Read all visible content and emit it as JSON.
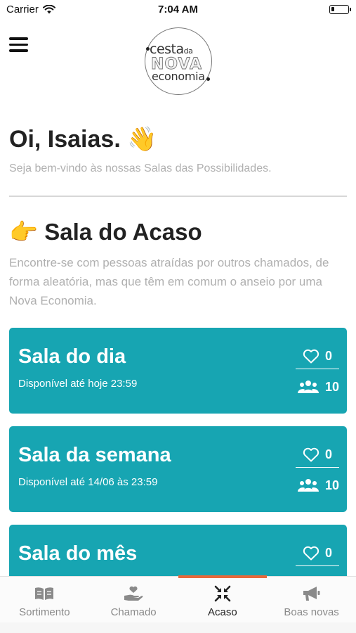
{
  "status_bar": {
    "carrier": "Carrier",
    "time": "7:04 AM"
  },
  "logo": {
    "line1": "cesta",
    "line1_small": "da",
    "line2": "NOVA",
    "line3": "economia"
  },
  "greeting": {
    "title": "Oi, Isaias. 👋",
    "subtitle": "Seja bem-vindo às nossas Salas das Possibilidades."
  },
  "section": {
    "title": "👉 Sala do Acaso",
    "description": "Encontre-se com pessoas atraídas por outros chamados, de forma aleatória, mas que têm em comum o anseio por uma Nova Economia."
  },
  "rooms": [
    {
      "title": "Sala do dia",
      "availability": "Disponível até hoje 23:59",
      "likes": "0",
      "members": "10"
    },
    {
      "title": "Sala da semana",
      "availability": "Disponível até 14/06 às 23:59",
      "likes": "0",
      "members": "10"
    },
    {
      "title": "Sala do mês",
      "availability": "",
      "likes": "0",
      "members": ""
    }
  ],
  "tabs": [
    {
      "label": "Sortimento",
      "icon": "book-open-icon",
      "active": false
    },
    {
      "label": "Chamado",
      "icon": "hand-heart-icon",
      "active": false
    },
    {
      "label": "Acaso",
      "icon": "compress-arrows-icon",
      "active": true
    },
    {
      "label": "Boas novas",
      "icon": "megaphone-icon",
      "active": false
    }
  ],
  "colors": {
    "card": "#17a5b2",
    "accent": "#e8683a",
    "muted_text": "#b0b0b0"
  }
}
